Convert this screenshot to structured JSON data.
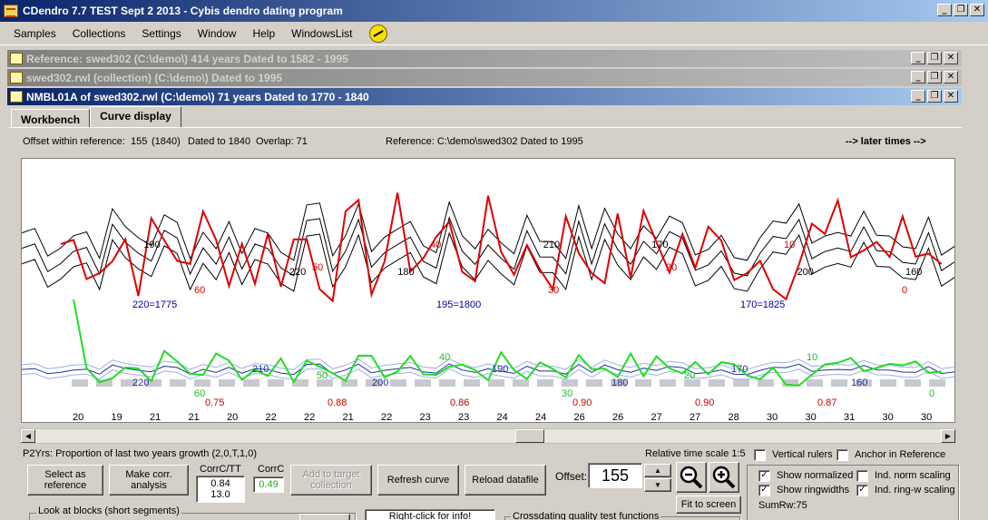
{
  "app": {
    "title": "CDendro 7.7 TEST Sept 2 2013 - Cybis dendro dating program",
    "minimize": "_",
    "restore": "❐",
    "close": "✕"
  },
  "menu": [
    "Samples",
    "Collections",
    "Settings",
    "Window",
    "Help",
    "WindowsList"
  ],
  "mdi": [
    {
      "title": "Reference: swed302    (C:\\demo\\)  414 years  Dated to 1582 - 1995"
    },
    {
      "title": "swed302.rwl (collection)  (C:\\demo\\) Dated to 1995"
    },
    {
      "title": "NMBL01A of swed302.rwl    (C:\\demo\\)  71 years  Dated to 1770 - 1840"
    }
  ],
  "tabs": [
    "Workbench",
    "Curve display"
  ],
  "info": {
    "offset_label": "Offset within reference:",
    "offset_value": "155",
    "offset_paren": "(1840)",
    "dated_to": "Dated to 1840",
    "overlap": "Overlap: 71",
    "reference": "Reference: C:\\demo\\swed302  Dated to 1995",
    "later_times": "--> later times -->"
  },
  "chart_data": {
    "type": "line",
    "colors": {
      "reference": "#000000",
      "sample": "#dd0000",
      "corr": "#22dd22",
      "index_ref": "#2030a0",
      "env": "#9ab0e8",
      "block": "#c8c8d0"
    },
    "upper_labels_black": [
      {
        "t": 220,
        "i": 5
      },
      {
        "t": 210,
        "i": 12
      },
      {
        "t": 200,
        "i": 19
      },
      {
        "t": 190,
        "i": 26
      },
      {
        "t": 180,
        "i": 33
      },
      {
        "t": 170,
        "i": 40
      },
      {
        "t": 160,
        "i": 47
      }
    ],
    "upper_labels_red": [
      {
        "t": "60",
        "i": 9
      },
      {
        "t": "50",
        "i": 16
      },
      {
        "t": "40",
        "i": 23
      },
      {
        "t": "30",
        "i": 30
      },
      {
        "t": "20",
        "i": 37
      },
      {
        "t": "10",
        "i": 44
      },
      {
        "t": "0",
        "i": 51
      }
    ],
    "year_markers": [
      "220=1775",
      "195=1800",
      "170=1825"
    ],
    "lower_labels_blue": [
      "220",
      "210",
      "200",
      "190",
      "180",
      "170",
      "160"
    ],
    "lower_labels_green": [
      "60",
      "50",
      "40",
      "30",
      "20",
      "10",
      "0"
    ],
    "block_correlations": [
      "0.75",
      "0.88",
      "0.86",
      "0.90",
      "0.90",
      "0.87"
    ],
    "xaxis_counts": [
      "20",
      "19",
      "21",
      "21",
      "20",
      "22",
      "22",
      "21",
      "22",
      "23",
      "23",
      "24",
      "24",
      "26",
      "26",
      "27",
      "27",
      "28",
      "30",
      "30",
      "31",
      "30",
      "30"
    ]
  },
  "bottom": {
    "p2yrs": "P2Yrs: Proportion of last two years growth (2,0,T,1,0)",
    "time_scale": "Relative time scale 1:5",
    "vertical_rulers": "Vertical rulers",
    "anchor_ref": "Anchor in Reference",
    "select_ref": "Select as reference",
    "make_corr": "Make corr. analysis",
    "corrc_tt_label": "CorrC/TT",
    "corrc_tt_1": "0.84",
    "corrc_tt_2": "13.0",
    "corrc_label": "CorrC",
    "corrc_value": "0.49",
    "add_target": "Add to target collection",
    "refresh": "Refresh curve",
    "reload": "Reload datafile",
    "offset_label": "Offset:",
    "offset_value": "155",
    "fit_screen": "Fit to screen",
    "show_normalized": "Show normalized",
    "show_ringwidths": "Show ringwidths",
    "ind_norm_scaling": "Ind. norm scaling",
    "ind_ring_scaling": "Ind. ring-w scaling",
    "sumrw": "SumRw:75",
    "look_blocks": "Look at blocks (short segments)",
    "right_click": "Right-click for info!",
    "crossdating": "Crossdating quality test functions",
    "checks": {
      "vertical_rulers": false,
      "anchor_ref": false,
      "show_normalized": true,
      "show_ringwidths": true,
      "ind_norm_scaling": false,
      "ind_ring_scaling": true
    }
  }
}
